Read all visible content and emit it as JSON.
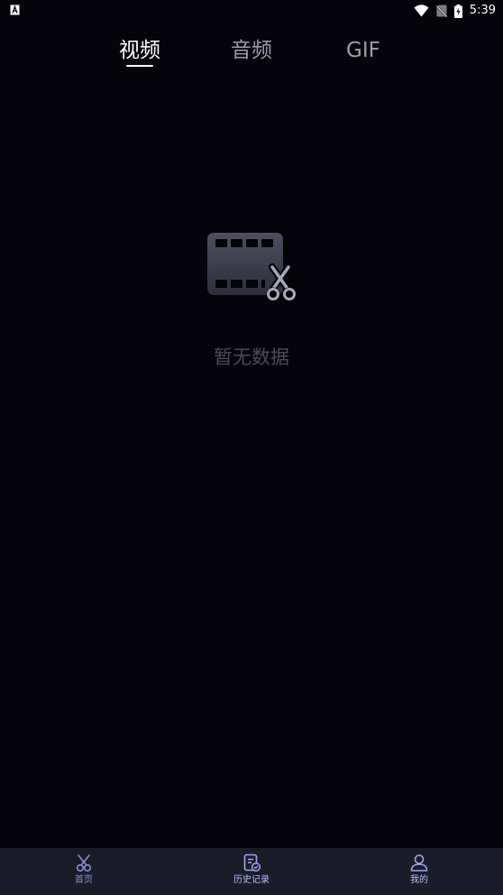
{
  "status_bar": {
    "time": "5:39"
  },
  "tabs": [
    {
      "label": "视频",
      "active": true
    },
    {
      "label": "音频",
      "active": false
    },
    {
      "label": "GIF",
      "active": false
    }
  ],
  "empty_state": {
    "icon": "film-scissors-icon",
    "text": "暂无数据"
  },
  "bottom_nav": [
    {
      "label": "首页",
      "icon": "scissors-icon",
      "active": true
    },
    {
      "label": "历史记录",
      "icon": "history-document-icon",
      "active": false
    },
    {
      "label": "我的",
      "icon": "user-icon",
      "active": false
    }
  ],
  "colors": {
    "background": "#05040b",
    "nav_background": "#1b1c2a",
    "nav_active": "#8a8fd6",
    "nav_inactive": "#9ea6e8",
    "tab_inactive": "#9c9cad",
    "empty_text": "#4b4b57"
  }
}
